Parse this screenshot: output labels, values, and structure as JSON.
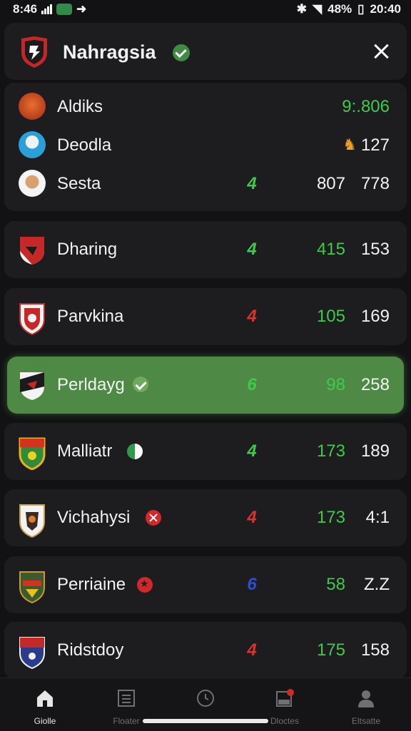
{
  "status_bar": {
    "time": "8:46",
    "battery": "48%",
    "clock": "20:40"
  },
  "header": {
    "title": "Nahragsia"
  },
  "top_group": [
    {
      "name": "Aldiks",
      "points": "9:.806",
      "value": ""
    },
    {
      "name": "Deodla",
      "points": "",
      "value": "127"
    },
    {
      "name": "Sesta",
      "rank": "4",
      "points": "807",
      "value": "778"
    }
  ],
  "rows": [
    {
      "name": "Dharing",
      "rank": "4",
      "points": "415",
      "value": "153"
    },
    {
      "name": "Parvkina",
      "rank": "4",
      "points": "105",
      "value": "169"
    },
    {
      "name": "Perldayg",
      "rank": "6",
      "points": "98",
      "value": "258"
    },
    {
      "name": "Malliatr",
      "rank": "4",
      "points": "173",
      "value": "189"
    },
    {
      "name": "Vichahysi",
      "rank": "4",
      "points": "173",
      "value": "4:1"
    },
    {
      "name": "Perriaine",
      "rank": "6",
      "points": "58",
      "value": "Z.Z"
    },
    {
      "name": "Ridstdoy",
      "rank": "4",
      "points": "175",
      "value": "158"
    }
  ],
  "bottom_nav": [
    {
      "label": "Giolle",
      "icon": "home-icon"
    },
    {
      "label": "Floater",
      "icon": "list-icon"
    },
    {
      "label": "",
      "icon": "clock-icon"
    },
    {
      "label": "Dloctes",
      "icon": "inbox-icon"
    },
    {
      "label": "Eltsatte",
      "icon": "profile-icon"
    }
  ],
  "colors": {
    "background": "#121214",
    "card": "#1d1d20",
    "highlight": "#4e8a45",
    "points_green": "#3ecb4b",
    "rank_green": "#3ecb4b",
    "rank_red": "#e0322b",
    "rank_blue": "#2f4fd0",
    "verified": "#3f8b43"
  }
}
